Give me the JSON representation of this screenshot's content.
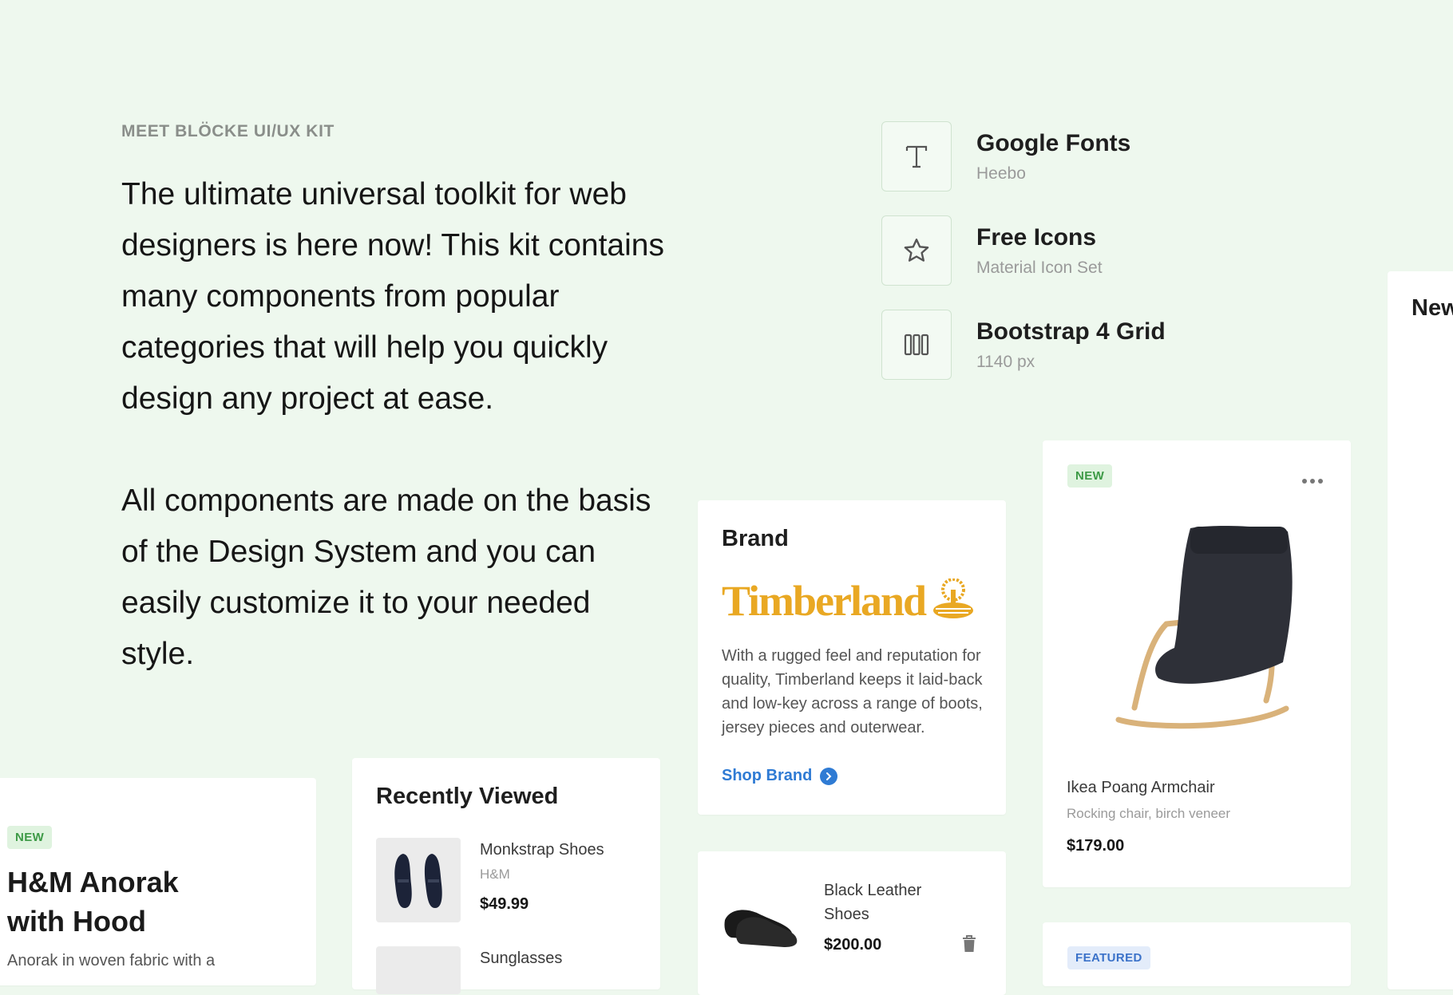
{
  "intro": {
    "eyebrow": "MEET BLÖCKE UI/UX KIT",
    "paragraph1": "The ultimate universal toolkit for web designers is here now! This kit contains many components from popular categories that will help you quickly design any project at ease.",
    "paragraph2": "All components are made on the basis of the Design System and you can easily customize it to your needed style."
  },
  "features": [
    {
      "title": "Google Fonts",
      "subtitle": "Heebo",
      "icon": "text-format-icon"
    },
    {
      "title": "Free Icons",
      "subtitle": "Material Icon Set",
      "icon": "star-outline-icon"
    },
    {
      "title": "Bootstrap 4 Grid",
      "subtitle": "1140 px",
      "icon": "grid-columns-icon"
    }
  ],
  "peek_card": {
    "title": "New"
  },
  "brand_card": {
    "title": "Brand",
    "logo_text": "Timberland",
    "description": "With a rugged feel and reputation for quality, Timberland keeps it laid-back and low-key across a range of boots, jersey pieces and outerwear.",
    "link_label": "Shop Brand",
    "logo_color": "#e9a823"
  },
  "product_card": {
    "badge": "NEW",
    "name": "Ikea Poang Armchair",
    "subtitle": "Rocking chair, birch veneer",
    "price": "$179.00"
  },
  "cart_item": {
    "name": "Black Leather Shoes",
    "price": "$200.00"
  },
  "featured_card": {
    "badge": "FEATURED"
  },
  "recently_viewed": {
    "title": "Recently Viewed",
    "items": [
      {
        "name": "Monkstrap Shoes",
        "brand": "H&M",
        "price": "$49.99"
      },
      {
        "name": "Sunglasses"
      }
    ]
  },
  "anorak_card": {
    "badge": "NEW",
    "title": "H&M Anorak with Hood",
    "description": "Anorak in woven fabric with a"
  },
  "colors": {
    "background": "#eef8ee",
    "accent_green": "#3d9a46",
    "link_blue": "#2f7bd4"
  }
}
